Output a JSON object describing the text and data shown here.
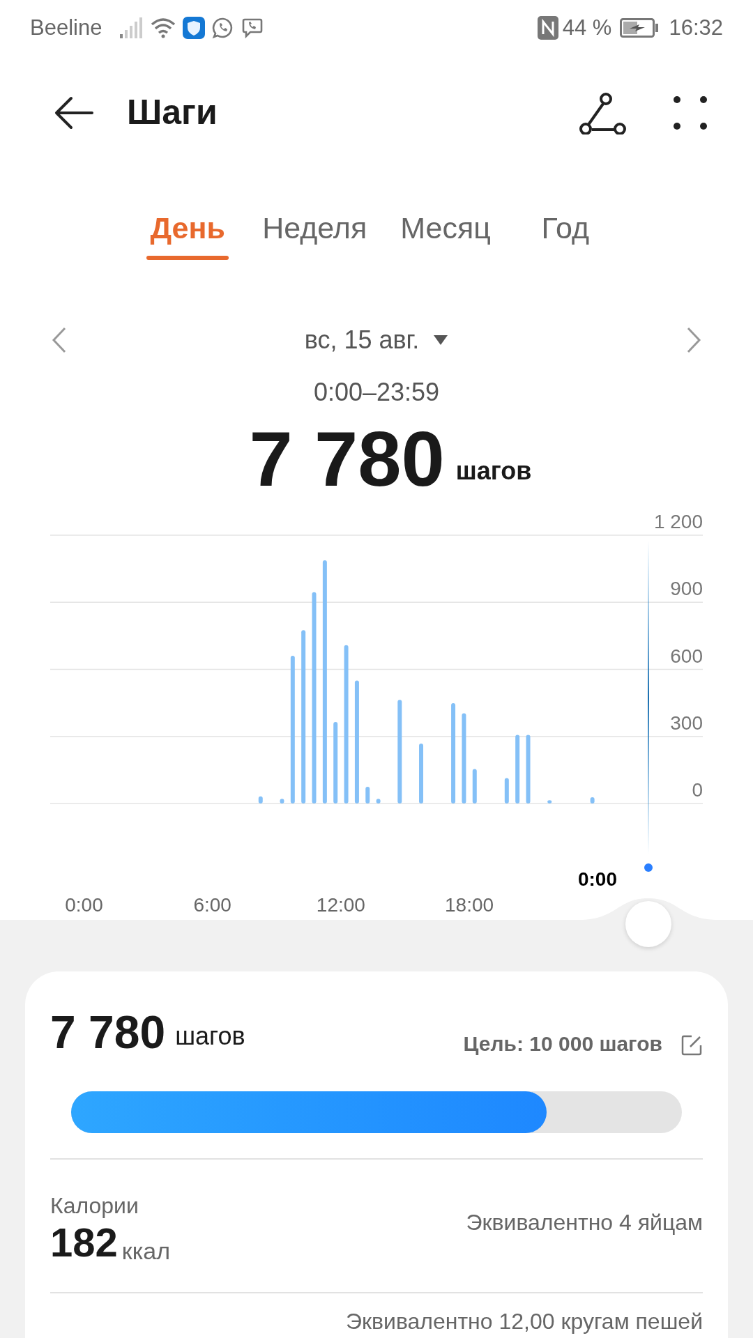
{
  "status_bar": {
    "carrier": "Beeline",
    "battery": "44 %",
    "time": "16:32"
  },
  "header": {
    "title": "Шаги"
  },
  "tabs": [
    {
      "label": "День",
      "selected": true
    },
    {
      "label": "Неделя",
      "selected": false
    },
    {
      "label": "Месяц",
      "selected": false
    },
    {
      "label": "Год",
      "selected": false
    }
  ],
  "date_nav": {
    "date": "вс, 15 авг.",
    "range": "0:00–23:59"
  },
  "total": {
    "value": "7 780",
    "unit": "шагов"
  },
  "chart": {
    "cursor_label": "0:00",
    "chart_data": {
      "type": "bar",
      "x": [
        8,
        9,
        9.5,
        10,
        10.5,
        11,
        11.5,
        12,
        12.5,
        13,
        13.5,
        14.5,
        15.5,
        17,
        17.5,
        18,
        19.5,
        20,
        20.5,
        21.5,
        23.5
      ],
      "grid": true,
      "series": [
        {
          "color": "#84c0f7",
          "values": [
            32,
            21,
            661,
            775,
            945,
            1088,
            365,
            708,
            550,
            75,
            21,
            464,
            268,
            449,
            404,
            154,
            114,
            307,
            307,
            15,
            28
          ]
        }
      ],
      "xlim": [
        0,
        24
      ],
      "ylim": [
        0,
        1200
      ],
      "xticks": [
        {
          "value": 0,
          "label": "0:00"
        },
        {
          "value": 6,
          "label": "6:00"
        },
        {
          "value": 12,
          "label": "12:00"
        },
        {
          "value": 18,
          "label": "18:00"
        }
      ],
      "yticks": [
        0,
        300,
        600,
        900,
        {
          "value": 1200,
          "label": "1 200"
        }
      ]
    }
  },
  "summary": {
    "steps": "7 780",
    "unit": "шагов",
    "goal": "Цель: 10 000 шагов",
    "level": 0.778
  },
  "stats": [
    {
      "kind": "metric",
      "label": "Калории",
      "value": "182",
      "unit": "ккал",
      "note": "Эквивалентно 4 яйцам"
    },
    {
      "kind": "note",
      "note": "Эквивалентно 12,00 кругам пешей"
    }
  ]
}
